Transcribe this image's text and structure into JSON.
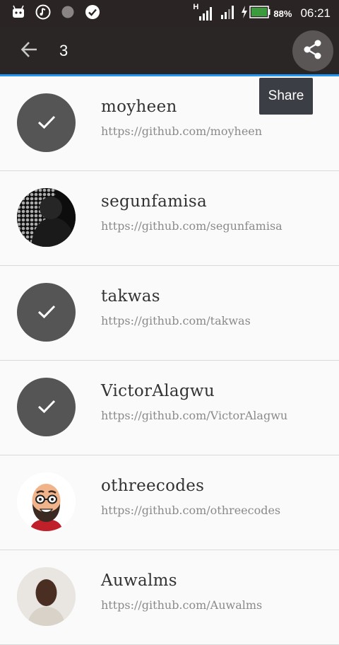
{
  "status_bar": {
    "icons_left": [
      "android-icon",
      "music-icon",
      "dot-icon",
      "check-circle-icon"
    ],
    "network_type": "H",
    "battery_percent": "88%",
    "time": "06:21"
  },
  "app_bar": {
    "selected_count": "3",
    "share_tooltip": "Share"
  },
  "colors": {
    "status_bar_bg": "#2b2424",
    "app_bar_bg": "#2b2626",
    "accent_line": "#2196f3",
    "checked_avatar_bg": "#555555",
    "battery_fill": "#3c9b3c"
  },
  "users": [
    {
      "username": "moyheen",
      "url": "https://github.com/moyheen",
      "selected": true
    },
    {
      "username": "segunfamisa",
      "url": "https://github.com/segunfamisa",
      "selected": false
    },
    {
      "username": "takwas",
      "url": "https://github.com/takwas",
      "selected": true
    },
    {
      "username": "VictorAlagwu",
      "url": "https://github.com/VictorAlagwu",
      "selected": true
    },
    {
      "username": "othreecodes",
      "url": "https://github.com/othreecodes",
      "selected": false
    },
    {
      "username": "Auwalms",
      "url": "https://github.com/Auwalms",
      "selected": false
    }
  ]
}
